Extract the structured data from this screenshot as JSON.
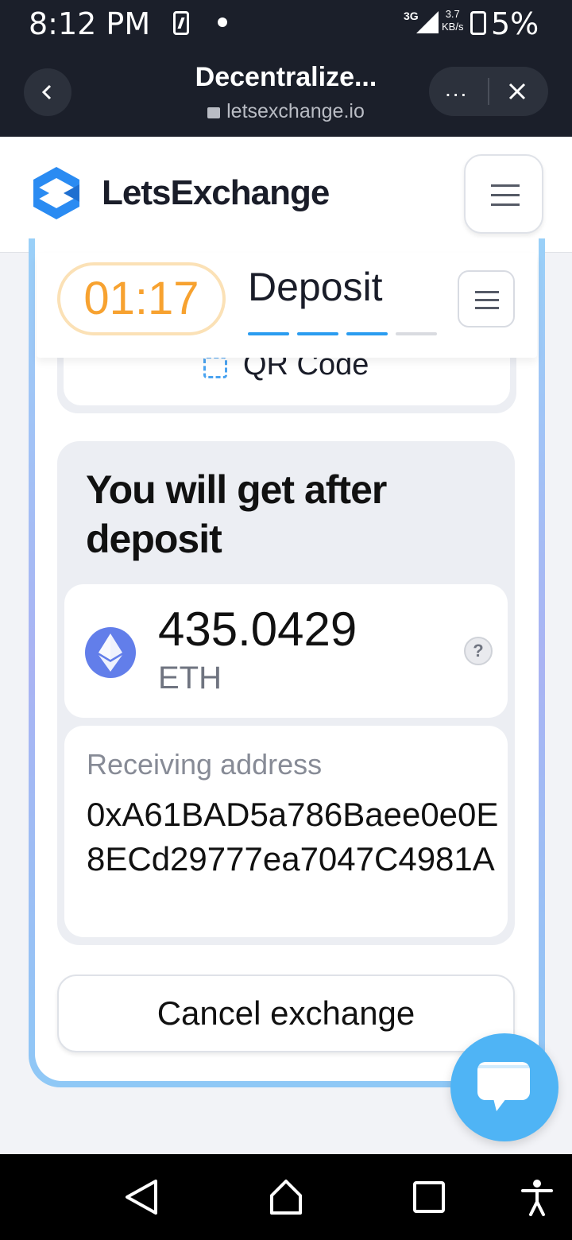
{
  "status_bar": {
    "time": "8:12 PM",
    "network": "3G",
    "speed_value": "3.7",
    "speed_unit": "KB/s",
    "battery": "5%"
  },
  "browser": {
    "title": "Decentralize...",
    "url": "letsexchange.io",
    "more_label": "..."
  },
  "site": {
    "logo_text": "LetsExchange",
    "brand_color": "#2a8bf2"
  },
  "exchange": {
    "timer": "01:17",
    "step_title": "Deposit",
    "progress_steps_completed": 3,
    "progress_steps_total": 4,
    "qr_label": "QR Code",
    "get_title": "You will get after deposit",
    "amount": "435.0429",
    "ticker": "ETH",
    "help_label": "?",
    "receiving_label": "Receiving address",
    "receiving_address": "0xA61BAD5a786Baee0e0E8ECd29777ea7047C4981A",
    "cancel_label": "Cancel exchange"
  },
  "colors": {
    "timer": "#f7a230",
    "eth": "#627eea",
    "chat": "#4fb4f5",
    "progress_active": "#2a9cf0",
    "progress_inactive": "#d9dbe0"
  }
}
